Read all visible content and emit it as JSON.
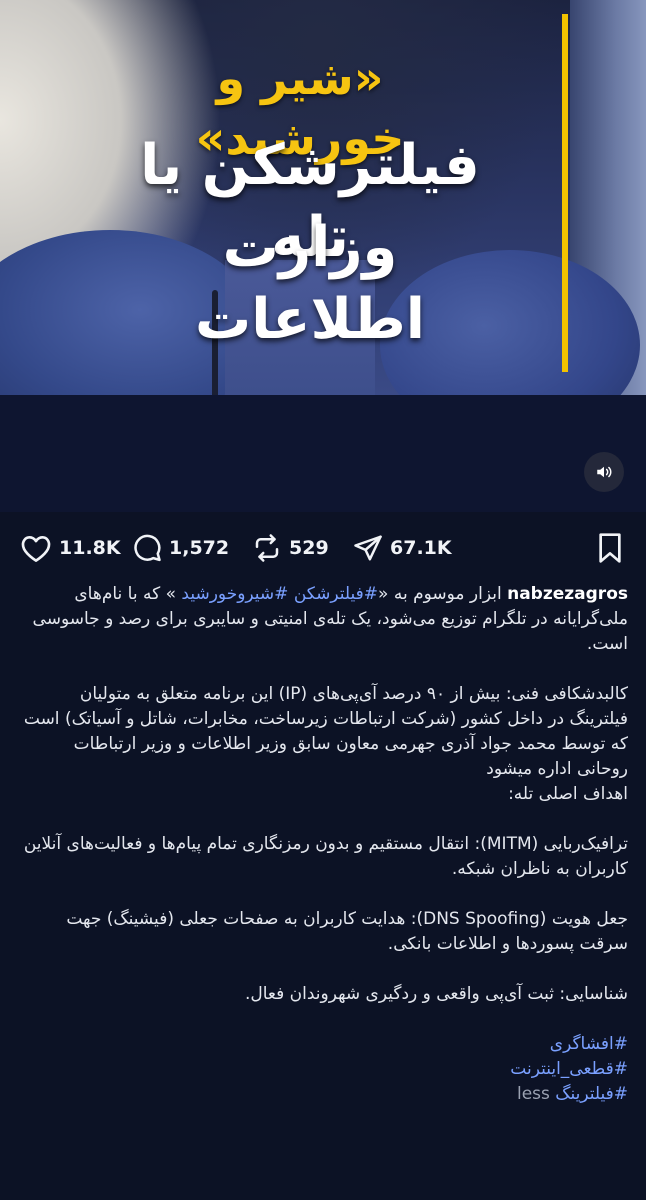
{
  "post": {
    "image_text": {
      "line1": "«شیر و خورشید»",
      "line2": "فیلترشکن یا تله",
      "line3": "وزارت اطلاعات"
    },
    "sound_icon": "speaker-icon"
  },
  "actions": {
    "likes": "11.8K",
    "comments": "1,572",
    "reposts": "529",
    "shares": "67.1K"
  },
  "caption": {
    "username": "nabzezagros",
    "intro_a": "ابزار موسوم به «",
    "intro_tags": "#فیلترشکن #شیروخورشید",
    "intro_b": " » که با نام‌های",
    "intro_rest": "ملی‌گرایانه در تلگرام توزیع می‌شود، یک تله‌ی امنیتی و سایبری برای رصد و جاسوسی است.",
    "p2": "کالبدشکافی فنی: بیش از ۹۰ درصد آی‌پی‌های (IP) این برنامه متعلق به متولیان فیلترینگ در داخل کشور (شرکت ارتباطات زیرساخت، مخابرات، شاتل و آسیاتک) است که توسط محمد جواد آذری جهرمی معاون سابق وزیر اطلاعات و وزیر ارتباطات روحانی اداره میشود",
    "p3": "اهداف اصلی تله:",
    "p4": "ترافیک‌ربایی (MITM): انتقال مستقیم و بدون رمزنگاری تمام پیام‌ها و فعالیت‌های آنلاین کاربران به ناظران شبکه.",
    "p5": "جعل هویت (DNS Spoofing): هدایت کاربران به صفحات جعلی (فیشینگ) جهت سرقت پسوردها و اطلاعات بانکی.",
    "p6": "شناسایی: ثبت آی‌پی واقعی و ردگیری شهروندان فعال.",
    "hashtags": [
      "#افشاگری",
      "#قطعی_اینترنت",
      "#فیلترینگ"
    ],
    "less": "less"
  }
}
